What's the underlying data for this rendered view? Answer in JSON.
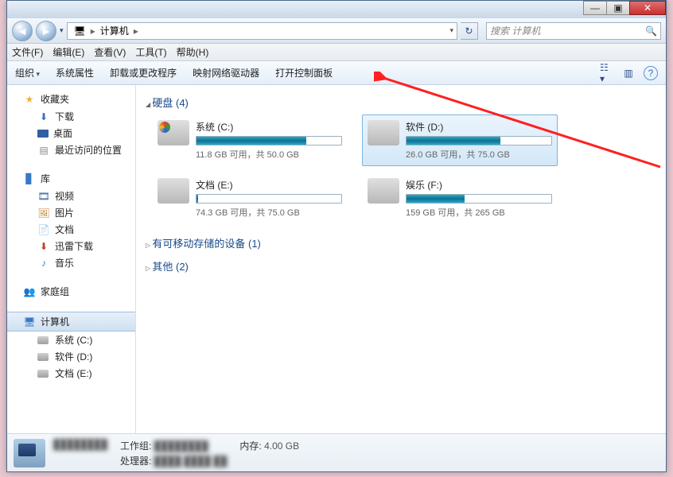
{
  "titlebar_buttons": {
    "min": "—",
    "max": "▣",
    "close": "✕"
  },
  "nav": {
    "back": "◄",
    "forward": "►",
    "dropdown": "▾",
    "refresh": "↻"
  },
  "address": {
    "root": "计算机",
    "sep": "▸",
    "drop": "▾"
  },
  "search": {
    "placeholder": "搜索 计算机",
    "icon": "🔍"
  },
  "menu": [
    "文件(F)",
    "编辑(E)",
    "查看(V)",
    "工具(T)",
    "帮助(H)"
  ],
  "toolbar": {
    "organize": "组织",
    "items": [
      "系统属性",
      "卸载或更改程序",
      "映射网络驱动器",
      "打开控制面板"
    ],
    "right_icons": [
      "view",
      "preview",
      "help"
    ]
  },
  "sidebar": {
    "favorites": {
      "label": "收藏夹",
      "items": [
        "下载",
        "桌面",
        "最近访问的位置"
      ]
    },
    "libraries": {
      "label": "库",
      "items": [
        "视频",
        "图片",
        "文档",
        "迅雷下载",
        "音乐"
      ]
    },
    "homegroup": {
      "label": "家庭组"
    },
    "computer": {
      "label": "计算机",
      "items": [
        "系统 (C:)",
        "软件 (D:)",
        "文档 (E:)"
      ]
    }
  },
  "groups": {
    "hdd": {
      "label": "硬盘 (4)"
    },
    "removable": {
      "label": "有可移动存储的设备 (1)"
    },
    "other": {
      "label": "其他 (2)"
    }
  },
  "drives": [
    {
      "name": "系统 (C:)",
      "sub": "11.8 GB 可用，共 50.0 GB",
      "fill": 76,
      "sys": true
    },
    {
      "name": "软件 (D:)",
      "sub": "26.0 GB 可用，共 75.0 GB",
      "fill": 65,
      "selected": true
    },
    {
      "name": "文档 (E:)",
      "sub": "74.3 GB 可用，共 75.0 GB",
      "fill": 1
    },
    {
      "name": "娱乐 (F:)",
      "sub": "159 GB 可用，共 265 GB",
      "fill": 40
    }
  ],
  "status": {
    "name_obscured": "████████",
    "workgroup_label": "工作组:",
    "workgroup_value": "████████",
    "memory_label": "内存:",
    "memory_value": "4.00 GB",
    "cpu_label": "处理器:",
    "cpu_value": "████ ████ ██"
  }
}
